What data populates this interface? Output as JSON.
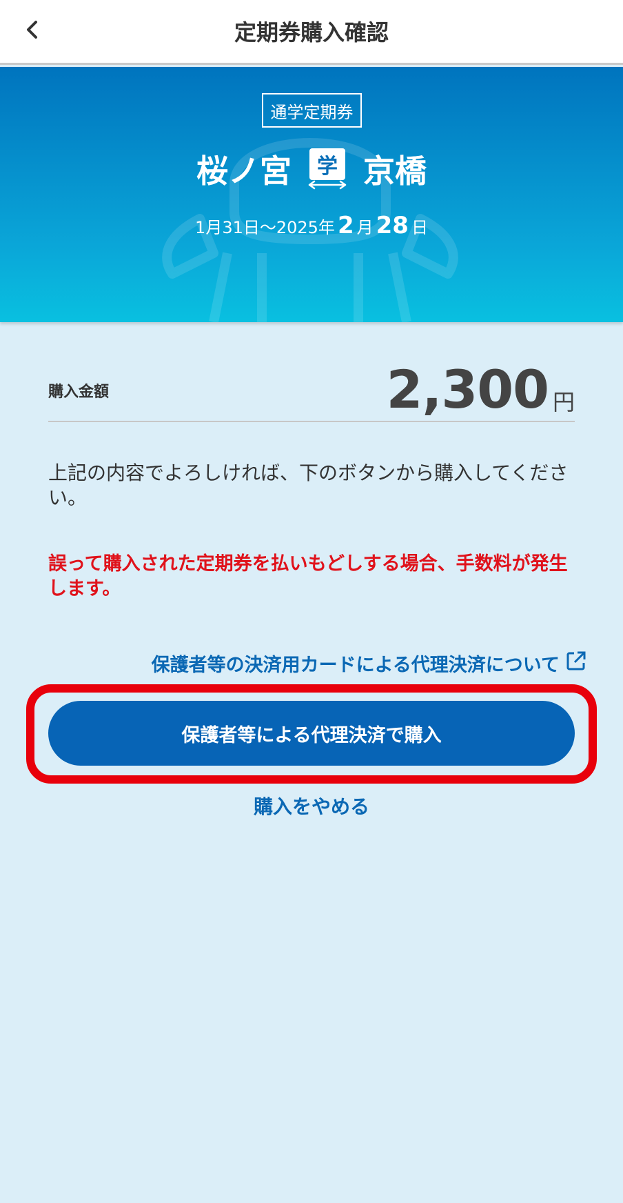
{
  "header": {
    "title": "定期券購入確認",
    "back_icon": "chevron-left-icon"
  },
  "ticket": {
    "type_label": "通学定期券",
    "from_station": "桜ノ宮",
    "to_station": "京橋",
    "student_badge": "学",
    "period_prefix": "1月31日〜2025年",
    "period_month": "2",
    "period_month_unit": "月",
    "period_day": "28",
    "period_day_unit": "日"
  },
  "price": {
    "label": "購入金額",
    "amount": "2,300",
    "unit": "円"
  },
  "notice_text": "上記の内容でよろしければ、下のボタンから購入してください。",
  "warning_text": "誤って購入された定期券を払いもどしする場合、手数料が発生します。",
  "proxy_link": {
    "label": "保護者等の決済用カードによる代理決済について",
    "icon": "external-link-icon"
  },
  "purchase_button_label": "保護者等による代理決済で購入",
  "cancel_label": "購入をやめる",
  "colors": {
    "primary": "#0764b6",
    "link": "#0b68b4",
    "warning": "#e0121b",
    "highlight": "#e8000b",
    "background": "#dbeef8"
  }
}
